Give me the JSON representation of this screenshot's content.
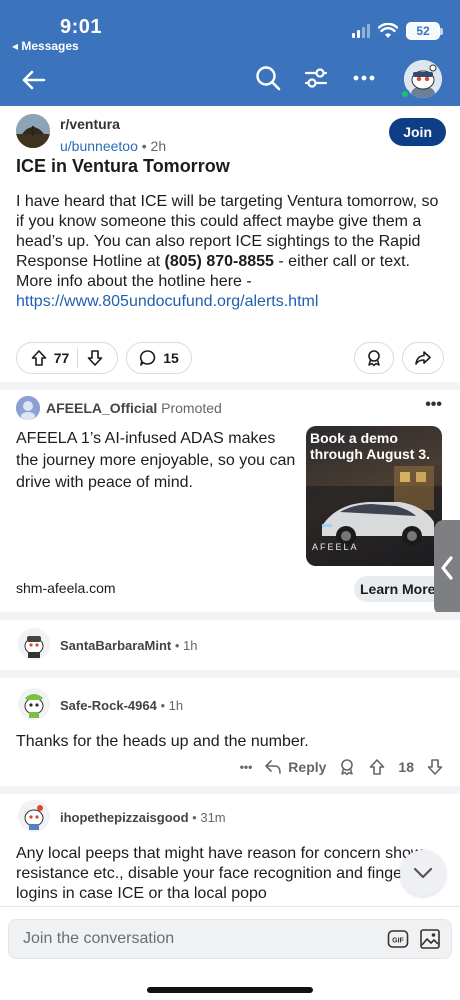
{
  "status": {
    "time": "9:01",
    "back_app": "◂ Messages",
    "battery": "52"
  },
  "post": {
    "subreddit": "r/ventura",
    "user": "u/bunneetoo",
    "time": "2h",
    "join": "Join",
    "title": "ICE in Ventura Tomorrow",
    "body_1": "I have heard that ICE will be targeting Ventura tomorrow, so if you know someone this could affect maybe give them a head’s up.  You can also report ICE sightings to the Rapid Response Hotline at ",
    "phone": "(805) 870-8855",
    "body_2": " - either call or text. More info about the hotline here - ",
    "link": "https://www.805undocufund.org/alerts.html",
    "upvotes": "77",
    "comments": "15"
  },
  "ad": {
    "name": "AFEELA_Official",
    "promoted": "Promoted",
    "text": "AFEELA 1’s AI-infused ADAS makes the journey more enjoyable, so you can drive with peace of mind.",
    "image_caption": "Book a demo through August 3.",
    "image_brand": "AFEELA",
    "domain": "shm-afeela.com",
    "cta": "Learn More"
  },
  "comments": [
    {
      "user": "SantaBarbaraMint",
      "time": "1h"
    },
    {
      "user": "Safe-Rock-4964",
      "time": "1h",
      "text": "Thanks for the heads up and the number.",
      "reply": "Reply",
      "score": "18",
      "more": "•••"
    },
    {
      "user": "ihopethepizzaisgood",
      "time": "31m",
      "text": "Any local peeps that might have reason for concern show resistance etc., disable your face recognition and fingerprint logins in case ICE or tha local popo"
    }
  ],
  "composer": {
    "placeholder": "Join the conversation",
    "gif": "GIF"
  },
  "colors": {
    "header": "#3b73bd",
    "join": "#0e3e86",
    "link": "#1f5fb0"
  }
}
